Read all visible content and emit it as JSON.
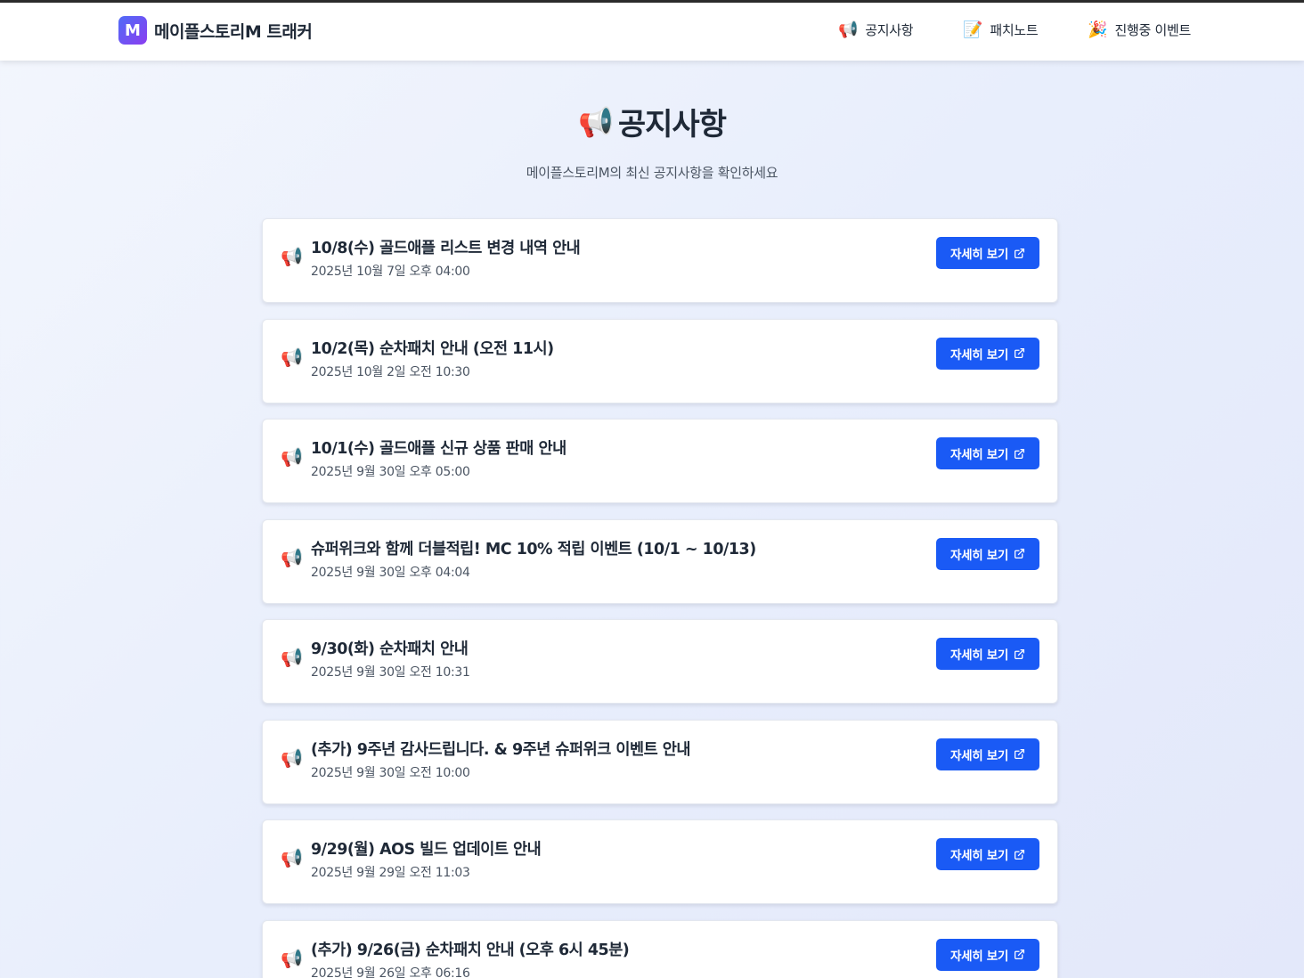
{
  "header": {
    "logo_letter": "M",
    "brand_name": "메이플스토리M 트래커",
    "nav": [
      {
        "icon": "📢",
        "label": "공지사항"
      },
      {
        "icon": "📝",
        "label": "패치노트"
      },
      {
        "icon": "🎉",
        "label": "진행중 이벤트"
      }
    ]
  },
  "hero": {
    "icon": "📢",
    "title": "공지사항",
    "subtitle": "메이플스토리M의 최신 공지사항을 확인하세요"
  },
  "notices": [
    {
      "icon": "📢",
      "title": "10/8(수) 골드애플 리스트 변경 내역 안내",
      "date": "2025년 10월 7일 오후 04:00",
      "button": "자세히 보기"
    },
    {
      "icon": "📢",
      "title": "10/2(목) 순차패치 안내 (오전 11시)",
      "date": "2025년 10월 2일 오전 10:30",
      "button": "자세히 보기"
    },
    {
      "icon": "📢",
      "title": "10/1(수) 골드애플 신규 상품 판매 안내",
      "date": "2025년 9월 30일 오후 05:00",
      "button": "자세히 보기"
    },
    {
      "icon": "📢",
      "title": "슈퍼위크와 함께 더블적립! MC 10% 적립 이벤트 (10/1 ~ 10/13)",
      "date": "2025년 9월 30일 오후 04:04",
      "button": "자세히 보기"
    },
    {
      "icon": "📢",
      "title": "9/30(화) 순차패치 안내",
      "date": "2025년 9월 30일 오전 10:31",
      "button": "자세히 보기"
    },
    {
      "icon": "📢",
      "title": "(추가) 9주년 감사드립니다. & 9주년 슈퍼위크 이벤트 안내",
      "date": "2025년 9월 30일 오전 10:00",
      "button": "자세히 보기"
    },
    {
      "icon": "📢",
      "title": "9/29(월) AOS 빌드 업데이트 안내",
      "date": "2025년 9월 29일 오전 11:03",
      "button": "자세히 보기"
    },
    {
      "icon": "📢",
      "title": "(추가) 9/26(금) 순차패치 안내 (오후 6시 45분)",
      "date": "2025년 9월 26일 오후 06:16",
      "button": "자세히 보기"
    }
  ],
  "colors": {
    "accent": "#1a5af5",
    "logo_gradient_start": "#4f6cf7",
    "logo_gradient_end": "#8b3df0"
  }
}
